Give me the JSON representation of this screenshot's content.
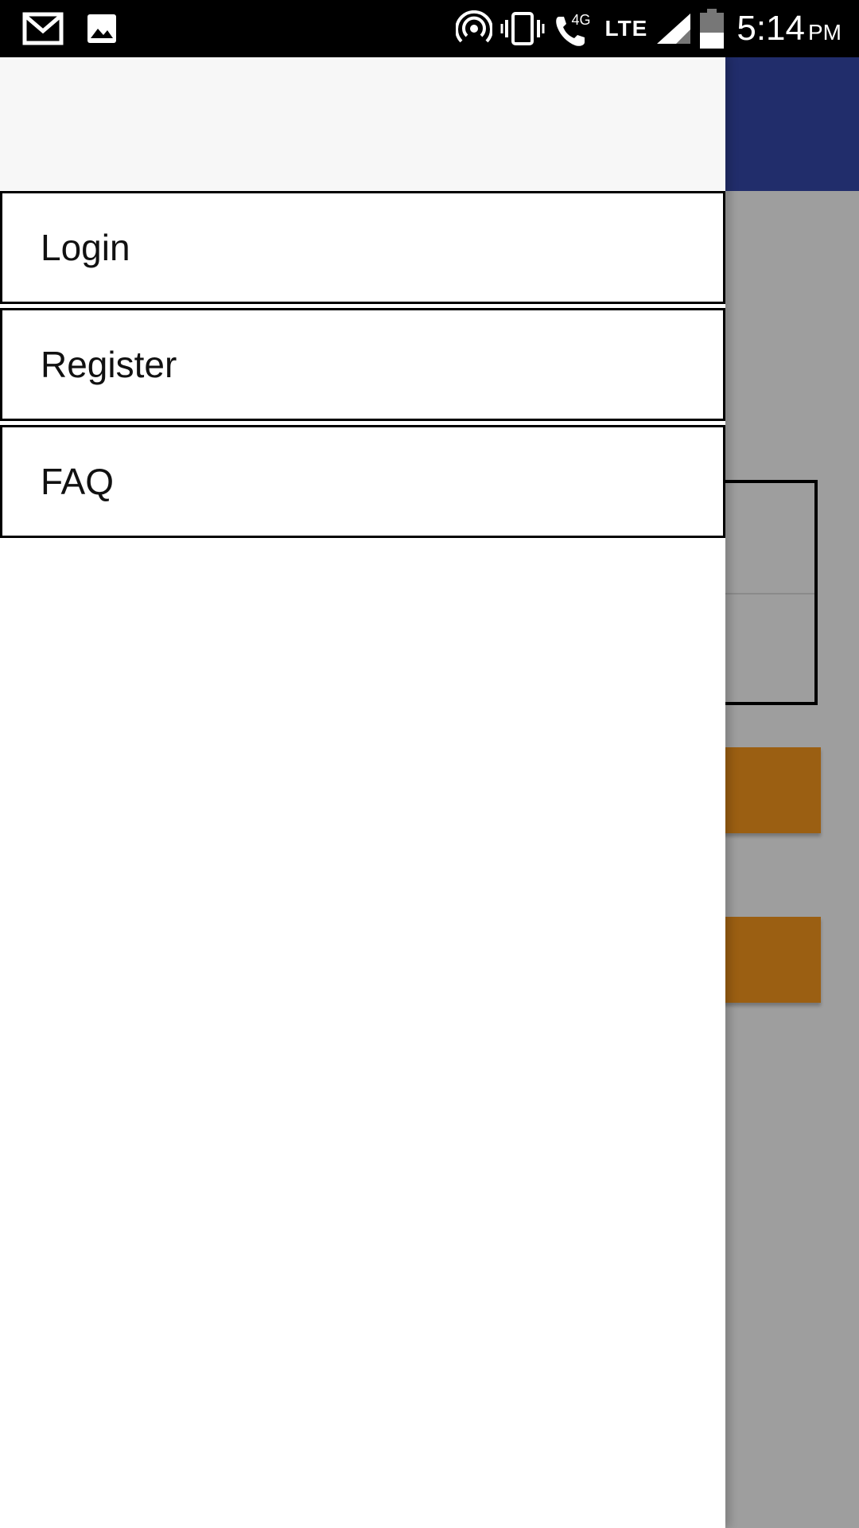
{
  "status_bar": {
    "icons_left": [
      "gmail-icon",
      "gallery-icon"
    ],
    "icons_right": [
      "hotspot-icon",
      "vibrate-icon",
      "wifi-call-icon",
      "signal-icon",
      "battery-icon"
    ],
    "call_badge": "4G",
    "network": "LTE",
    "time": "5:14",
    "ampm": "PM"
  },
  "drawer": {
    "items": [
      {
        "label": "Login"
      },
      {
        "label": "Register"
      },
      {
        "label": "FAQ"
      }
    ]
  },
  "colors": {
    "toolbar": "#212d6b",
    "accent_button": "#9b5f12",
    "scrim": "#9e9e9e",
    "drawer_header": "#f7f7f7"
  }
}
